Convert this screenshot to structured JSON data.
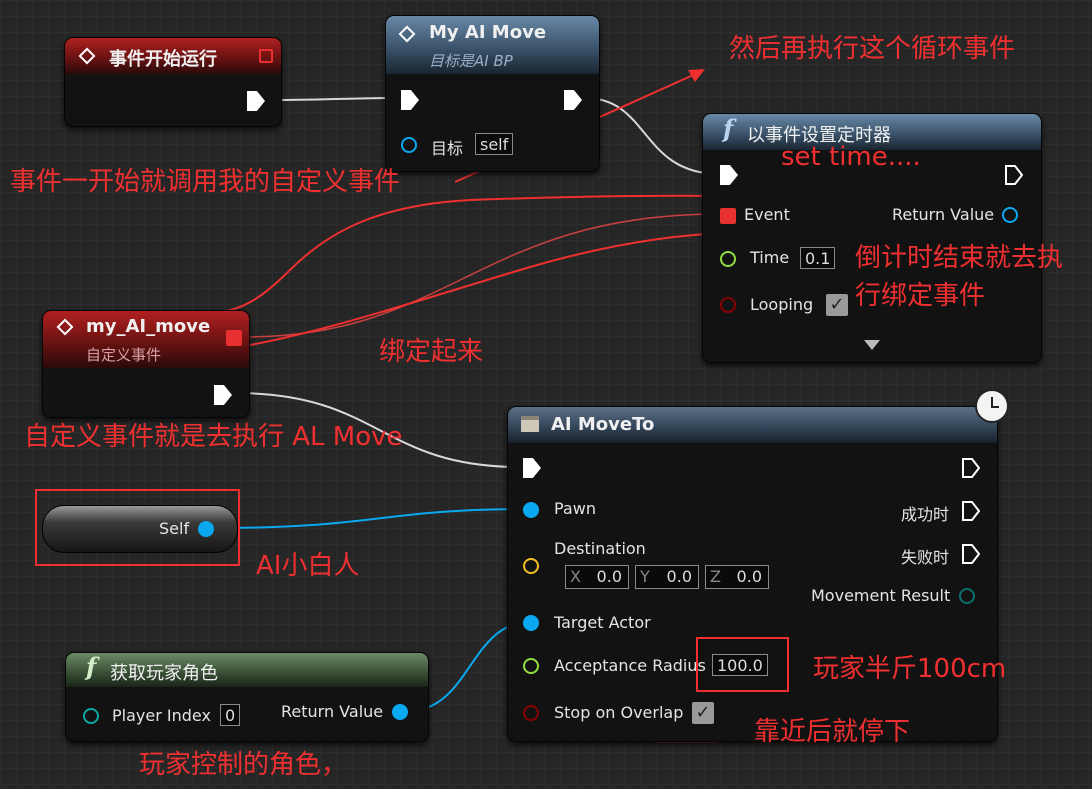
{
  "nodes": {
    "begin_play": {
      "title": "事件开始运行"
    },
    "my_ai_move_call": {
      "title": "My AI Move",
      "subtitle": "目标是AI BP",
      "target_label": "目标",
      "target_value": "self"
    },
    "set_timer": {
      "title": "以事件设置定时器",
      "event_label": "Event",
      "return_label": "Return Value",
      "time_label": "Time",
      "time_value": "0.1",
      "looping_label": "Looping",
      "looping_checked": true
    },
    "custom_event": {
      "title": "my_AI_move",
      "subtitle": "自定义事件"
    },
    "ai_moveto": {
      "title": "AI MoveTo",
      "pawn_label": "Pawn",
      "destination_label": "Destination",
      "dest_x_label": "X",
      "dest_x": "0.0",
      "dest_y_label": "Y",
      "dest_y": "0.0",
      "dest_z_label": "Z",
      "dest_z": "0.0",
      "success_label": "成功时",
      "fail_label": "失败时",
      "movement_result_label": "Movement Result",
      "target_actor_label": "Target Actor",
      "acceptance_label": "Acceptance Radius",
      "acceptance_value": "100.0",
      "stop_overlap_label": "Stop on Overlap",
      "stop_overlap_checked": true
    },
    "self_node": {
      "label": "Self"
    },
    "get_player": {
      "title": "获取玩家角色",
      "index_label": "Player Index",
      "index_value": "0",
      "return_label": "Return Value"
    }
  },
  "annotations": {
    "then_loop": "然后再执行这个循环事件",
    "set_time": "set time....",
    "call_custom": "事件一开始就调用我的自定义事件",
    "countdown_line1": "倒计时结束就去执",
    "countdown_line2": "行绑定事件",
    "bind": "绑定起来",
    "custom_exec": "自定义事件就是去执行 AL Move",
    "ai_pawn": "AI小白人",
    "radius": "玩家半斤100cm",
    "stop_near": "靠近后就停下",
    "player_char": "玩家控制的角色，"
  },
  "colors": {
    "annotation": "#f03030",
    "object_pin": "#0aa8f0",
    "vector_pin": "#f0c020",
    "float_pin": "#90e040",
    "bool_pin": "#8a0000",
    "delegate_pin": "#e83030",
    "struct_pin": "#0a7070"
  },
  "icons": [
    "event-diamond-icon",
    "function-f-icon",
    "latent-clock-icon",
    "exec-pin-icon",
    "checkbox-icon",
    "delegate-pin-icon"
  ]
}
